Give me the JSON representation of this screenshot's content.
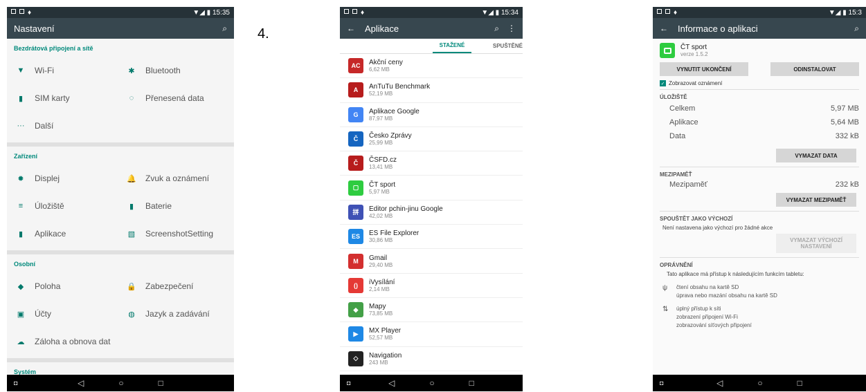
{
  "label4": "4.",
  "screen1": {
    "status_time": "15:35",
    "title": "Nastavení",
    "sections": [
      {
        "title": "Bezdrátová připojení a sítě",
        "rows": [
          [
            "Wi-Fi",
            "Bluetooth"
          ],
          [
            "SIM karty",
            "Přenesená data"
          ],
          [
            "Další",
            ""
          ]
        ]
      },
      {
        "title": "Zařízení",
        "rows": [
          [
            "Displej",
            "Zvuk a oznámení"
          ],
          [
            "Úložiště",
            "Baterie"
          ],
          [
            "Aplikace",
            "ScreenshotSetting"
          ]
        ]
      },
      {
        "title": "Osobní",
        "rows": [
          [
            "Poloha",
            "Zabezpečení"
          ],
          [
            "Účty",
            "Jazyk a zadávání"
          ],
          [
            "Záloha a obnova dat",
            ""
          ]
        ]
      },
      {
        "title": "Systém",
        "rows": []
      }
    ]
  },
  "screen2": {
    "status_time": "15:34",
    "title": "Aplikace",
    "tabs": [
      "STAŽENÉ",
      "SPUŠTĚNÉ"
    ],
    "apps": [
      {
        "name": "Akční ceny",
        "size": "6,62 MB",
        "color": "#c62828",
        "glyph": "AC"
      },
      {
        "name": "AnTuTu Benchmark",
        "size": "52,19 MB",
        "color": "#b71c1c",
        "glyph": "A"
      },
      {
        "name": "Aplikace Google",
        "size": "87,97 MB",
        "color": "#4285f4",
        "glyph": "G"
      },
      {
        "name": "Česko Zprávy",
        "size": "25,99 MB",
        "color": "#1565c0",
        "glyph": "Č"
      },
      {
        "name": "ČSFD.cz",
        "size": "13,41 MB",
        "color": "#b71c1c",
        "glyph": "Č"
      },
      {
        "name": "ČT sport",
        "size": "5,97 MB",
        "color": "#2ecc40",
        "glyph": "▢"
      },
      {
        "name": "Editor pchin-jinu Google",
        "size": "42,02 MB",
        "color": "#3f51b5",
        "glyph": "拼"
      },
      {
        "name": "ES File Explorer",
        "size": "30,86 MB",
        "color": "#1e88e5",
        "glyph": "ES"
      },
      {
        "name": "Gmail",
        "size": "29,40 MB",
        "color": "#d32f2f",
        "glyph": "M"
      },
      {
        "name": "iVysílání",
        "size": "2,14 MB",
        "color": "#e53935",
        "glyph": "()"
      },
      {
        "name": "Mapy",
        "size": "73,85 MB",
        "color": "#43a047",
        "glyph": "◆"
      },
      {
        "name": "MX Player",
        "size": "52,57 MB",
        "color": "#1e88e5",
        "glyph": "▶"
      },
      {
        "name": "Navigation",
        "size": "243 MB",
        "color": "#222222",
        "glyph": "◇"
      }
    ]
  },
  "screen3": {
    "status_time": "15:3",
    "title": "Informace o aplikaci",
    "app_name": "ČT sport",
    "version": "verze 1.5.2",
    "force_stop": "VYNUTIT UKONČENÍ",
    "uninstall": "ODINSTALOVAT",
    "show_notif": "Zobrazovat oznámení",
    "storage_title": "ÚLOŽIŠTĚ",
    "storage": [
      [
        "Celkem",
        "5,97 MB"
      ],
      [
        "Aplikace",
        "5,64 MB"
      ],
      [
        "Data",
        "332 kB"
      ]
    ],
    "clear_data": "VYMAZAT DATA",
    "cache_title": "MEZIPAMĚŤ",
    "cache_label": "Mezipaměť",
    "cache_value": "232 kB",
    "clear_cache": "VYMAZAT MEZIPAMĚŤ",
    "default_title": "SPOUŠTĚT JAKO VÝCHOZÍ",
    "default_text": "Není nastavena jako výchozí pro žádné akce",
    "clear_default": "VYMAZAT VÝCHOZÍ NASTAVENÍ",
    "perm_title": "OPRÁVNĚNÍ",
    "perm_text": "Tato aplikace má přístup k následujícím funkcím tabletu:",
    "perm1": [
      "čtení obsahu na kartě SD",
      "úprava nebo mazání obsahu na kartě SD"
    ],
    "perm2": [
      "úplný přístup k síti",
      "zobrazení připojení Wi-Fi",
      "zobrazování síťových připojení"
    ]
  }
}
